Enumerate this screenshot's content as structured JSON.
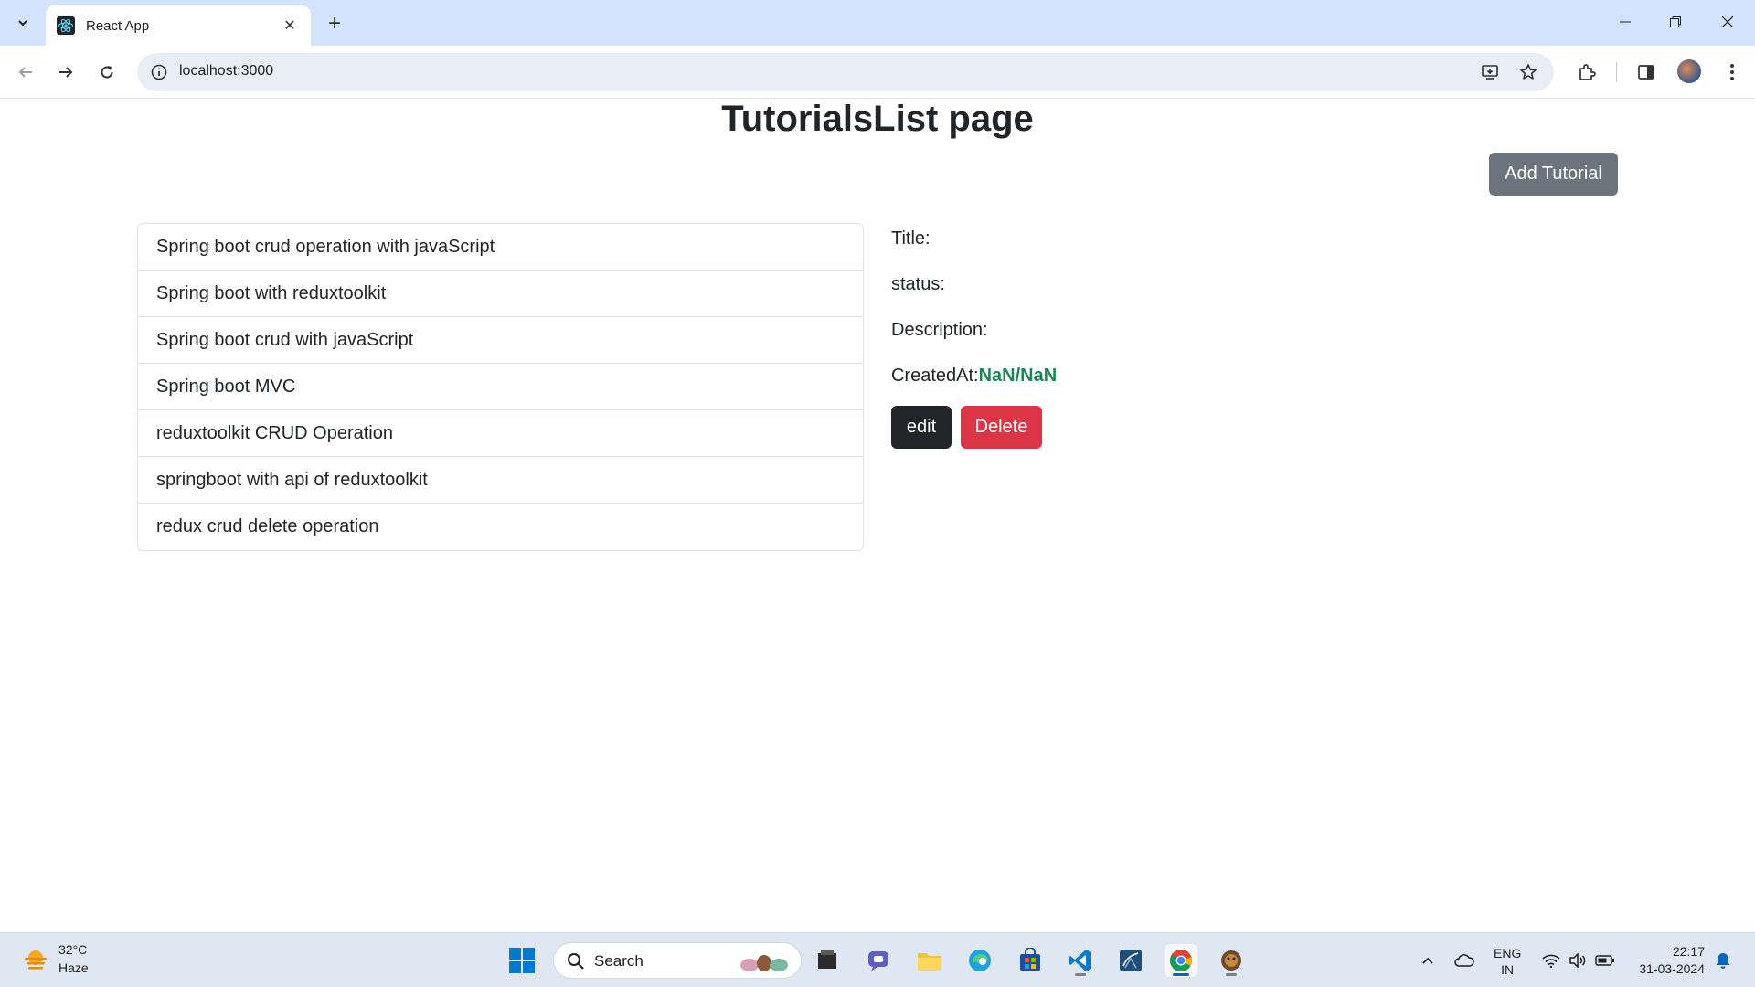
{
  "browser": {
    "tab_title": "React App",
    "url": "localhost:3000"
  },
  "page": {
    "title": "TutorialsList page",
    "add_button_label": "Add Tutorial",
    "tutorials": [
      "Spring boot crud operation with javaScript",
      "Spring boot with reduxtoolkit",
      "Spring boot crud with javaScript",
      "Spring boot MVC",
      "reduxtoolkit CRUD Operation",
      "springboot with api of reduxtoolkit",
      "redux crud delete operation"
    ],
    "details": {
      "title_label": "Title:",
      "status_label": "status:",
      "description_label": "Description:",
      "created_label": "CreatedAt:",
      "created_value": "NaN/NaN"
    },
    "edit_label": "edit",
    "delete_label": "Delete",
    "colors": {
      "add_button": "#6c757d",
      "edit_button": "#212529",
      "delete_button": "#dc3545",
      "created_value": "#198754"
    }
  },
  "taskbar": {
    "weather_temp": "32°C",
    "weather_desc": "Haze",
    "search_placeholder": "Search",
    "lang_line1": "ENG",
    "lang_line2": "IN",
    "time": "22:17",
    "date": "31-03-2024",
    "apps": [
      "file-manager-icon",
      "chat-icon",
      "file-explorer-icon",
      "edge-icon",
      "store-icon",
      "vscode-icon",
      "sql-app-icon",
      "chrome-icon",
      "bug-app-icon"
    ]
  }
}
